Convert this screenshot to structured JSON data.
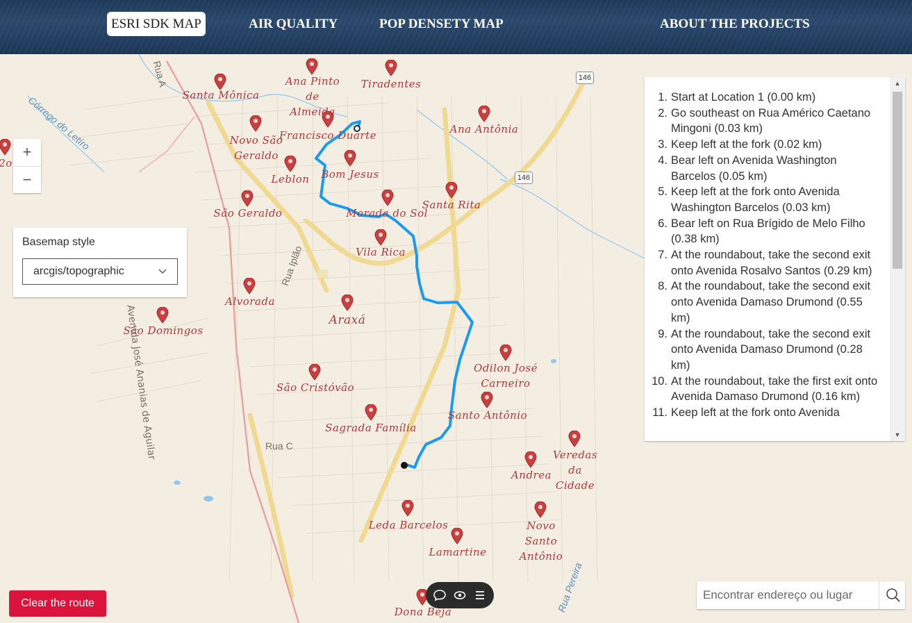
{
  "nav": {
    "items": [
      {
        "label": "ESRI SDK MAP",
        "active": true
      },
      {
        "label": "AIR QUALITY",
        "active": false
      },
      {
        "label": "POP DENSETY MAP",
        "active": false
      },
      {
        "label": "ABOUT THE PROJECTS",
        "active": false
      }
    ]
  },
  "map": {
    "neighborhoods": [
      "Santa Mônica",
      "Ana Pinto de Almeida",
      "Tiradentes",
      "Novo São Geraldo",
      "Francisco Duarte",
      "Ana Antônia",
      "Leblon",
      "Bom Jesus",
      "São Geraldo",
      "Morada do Sol",
      "Santa Rita",
      "Vila Rica",
      "Alvorada",
      "Araxá",
      "São Domingos",
      "Odilon José Carneiro",
      "São Cristóvão",
      "Santo Antônio",
      "Sagrada Família",
      "Veredas da Cidade",
      "Andrea",
      "Leda Barcelos",
      "Novo Santo Antônio",
      "Lamartine",
      "Dona Beja"
    ],
    "streets": [
      "Avenida José Ananias de Aguilar",
      "Rua Iplão",
      "Rua C",
      "Córrego do Letíro",
      "Rua A",
      "Rua Pereira"
    ],
    "shields": [
      "146",
      "146"
    ],
    "partial_label": "2o"
  },
  "zoom": {
    "in": "+",
    "out": "−"
  },
  "basemap": {
    "label": "Basemap style",
    "selected": "arcgis/topographic"
  },
  "directions": [
    "Start at Location 1 (0.00 km)",
    "Go southeast on Rua Américo Caetano Mingoni (0.03 km)",
    "Keep left at the fork (0.02 km)",
    "Bear left on Avenida Washington Barcelos (0.05 km)",
    "Keep left at the fork onto Avenida Washington Barcelos (0.03 km)",
    "Bear left on Rua Brígido de Melo Filho (0.38 km)",
    "At the roundabout, take the second exit onto Avenida Rosalvo Santos (0.29 km)",
    "At the roundabout, take the second exit onto Avenida Damaso Drumond (0.55 km)",
    "At the roundabout, take the second exit onto Avenida Damaso Drumond (0.28 km)",
    "At the roundabout, take the first exit onto Avenida Damaso Drumond (0.16 km)",
    "Keep left at the fork onto Avenida"
  ],
  "search": {
    "placeholder": "Encontrar endereço ou lugar"
  },
  "clear_button": "Clear the route",
  "colors": {
    "route": "#1a9bf0",
    "pin": "#c9403f",
    "label": "#b3363b",
    "clear": "#dc143c"
  },
  "icons": [
    "search-icon",
    "chat-icon",
    "eye-icon",
    "menu-icon",
    "chevron-down-icon",
    "map-pin-icon"
  ]
}
